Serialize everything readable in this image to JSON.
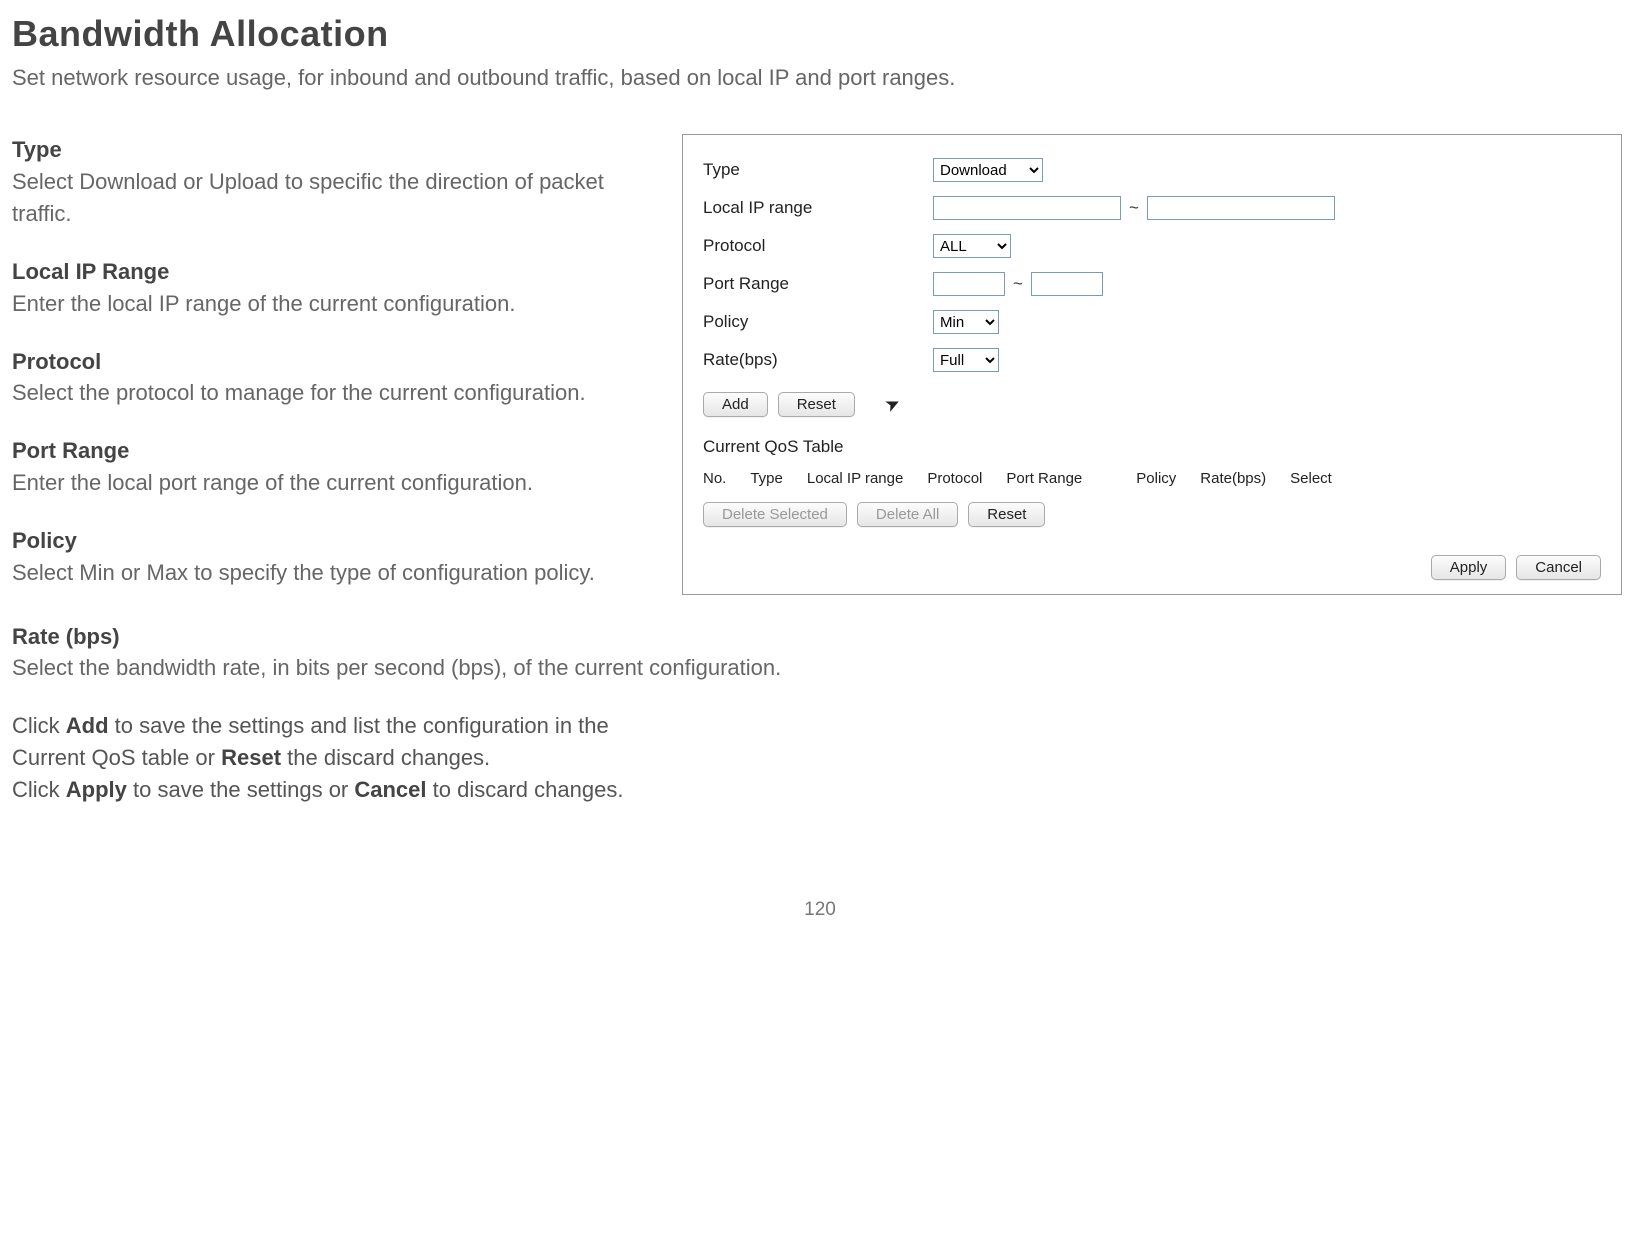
{
  "header": {
    "title": "Bandwidth Allocation",
    "subtitle": "Set network resource usage, for inbound and outbound traffic, based on local IP and port ranges."
  },
  "sections": {
    "type": {
      "label": "Type",
      "text": "Select Download or Upload to specific the direction of packet traffic."
    },
    "localip": {
      "label": "Local IP Range",
      "text": "Enter the local IP range of the current configuration."
    },
    "protocol": {
      "label": "Protocol",
      "text": "Select the protocol to manage for the current configuration."
    },
    "portrange": {
      "label": "Port Range",
      "text": "Enter the local port range of the current configuration."
    },
    "policy": {
      "label": "Policy",
      "text": "Select Min or Max to specify the type of configuration policy."
    },
    "rate": {
      "label": "Rate (bps)",
      "text": "Select the bandwidth rate, in bits per second (bps), of the current configuration."
    }
  },
  "dialog": {
    "labels": {
      "type": "Type",
      "localip": "Local IP range",
      "protocol": "Protocol",
      "portrange": "Port Range",
      "policy": "Policy",
      "rate": "Rate(bps)"
    },
    "values": {
      "type": "Download",
      "protocol": "ALL",
      "policy": "Min",
      "rate": "Full"
    },
    "separator": "~",
    "buttons": {
      "add": "Add",
      "reset": "Reset",
      "delete_selected": "Delete Selected",
      "delete_all": "Delete All",
      "reset2": "Reset",
      "apply": "Apply",
      "cancel": "Cancel"
    },
    "qos": {
      "title": "Current QoS Table",
      "headers": {
        "no": "No.",
        "type": "Type",
        "localip": "Local IP range",
        "protocol": "Protocol",
        "portrange": "Port Range",
        "policy": "Policy",
        "rate": "Rate(bps)",
        "select": "Select"
      }
    }
  },
  "footer": {
    "line1_a": "Click ",
    "line1_add": "Add",
    "line1_b": " to save the settings and list the configuration in the",
    "line2_a": "Current QoS table or ",
    "line2_reset": "Reset",
    "line2_b": " the discard changes.",
    "line3_a": "Click ",
    "line3_apply": "Apply",
    "line3_b": " to save the settings or ",
    "line3_cancel": "Cancel",
    "line3_c": " to discard changes."
  },
  "page_number": "120"
}
